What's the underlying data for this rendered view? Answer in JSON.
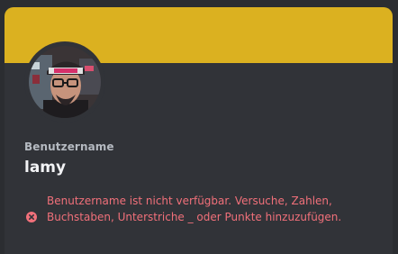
{
  "profile": {
    "banner_color": "#dbb120",
    "avatar_icon": "user-avatar-photo",
    "username_label": "Benutzername",
    "username_value": "lamy"
  },
  "error": {
    "icon": "error-circle-x-icon",
    "color": "#f1707a",
    "message": "Benutzername ist nicht verfügbar. Versuche, Zahlen, Buchstaben, Unterstriche _ oder Punkte hinzuzufügen."
  }
}
